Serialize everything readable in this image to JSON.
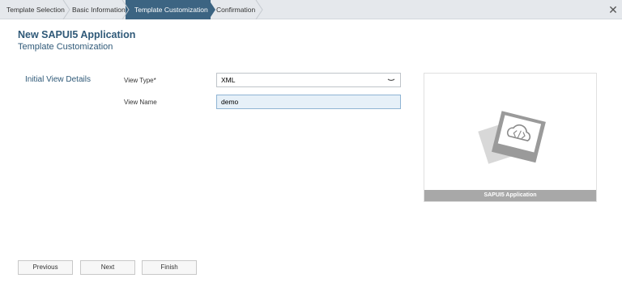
{
  "wizard": {
    "steps": [
      {
        "label": "Template Selection",
        "active": false
      },
      {
        "label": "Basic Information",
        "active": false
      },
      {
        "label": "Template Customization",
        "active": true
      },
      {
        "label": "Confirmation",
        "active": false
      }
    ],
    "close_icon": "close-icon",
    "close_glyph": "✕"
  },
  "header": {
    "title": "New SAPUI5 Application",
    "subtitle": "Template Customization"
  },
  "form": {
    "section_label": "Initial View Details",
    "view_type": {
      "label": "View Type*",
      "value": "XML"
    },
    "view_name": {
      "label": "View Name",
      "value": "demo"
    }
  },
  "preview": {
    "caption": "SAPUI5 Application",
    "icon": "cloud-code-icon"
  },
  "footer": {
    "previous_label": "Previous",
    "next_label": "Next",
    "finish_label": "Finish"
  },
  "colors": {
    "active_step": "#3c6482",
    "title": "#2f5978",
    "stepbar_bg": "#e5e8ec"
  }
}
